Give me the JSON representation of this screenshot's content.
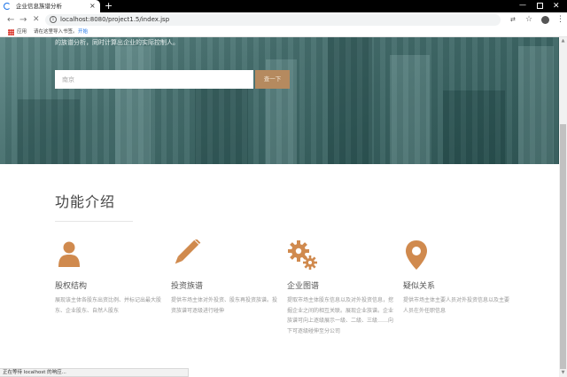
{
  "browser": {
    "tab_title": "企业信息族谱分析",
    "tab_close": "×",
    "new_tab": "+",
    "url": "localhost:8080/project1.5/index.jsp",
    "bookmarks": {
      "apps_label": "应用",
      "import_prompt": "请在这里导入书签。",
      "start_link": "开始"
    },
    "status_text": "正在等待 localhost 的响应..."
  },
  "hero": {
    "description": "的族谱分析，同时计算出企业的实际控制人。",
    "search_placeholder": "南京",
    "search_button": "查一下",
    "accent_color": "#b58a5f"
  },
  "features": {
    "title": "功能介绍",
    "icon_color": "#d08a4e",
    "items": [
      {
        "icon": "person-icon",
        "title": "股权结构",
        "desc": "展现该主体各股东出资比例、并标记出最大股东、企业股东、自然人股东"
      },
      {
        "icon": "pencil-icon",
        "title": "投资族谱",
        "desc": "提供市场主体对外投资、股东再投资族谱。投资族谱可逐级进行碰伸"
      },
      {
        "icon": "gears-icon",
        "title": "企业图谱",
        "desc": "提取市场主体股东信息以及对外投资信息，挖掘企业之间的相互关联。展现企业族谱。企业族谱可向上逐级展示一级、二级、三级……向下可逐级碰伸至分公司"
      },
      {
        "icon": "map-pin-icon",
        "title": "疑似关系",
        "desc": "提供市场主体主要人员对外投资信息以及主要人员在外任职信息"
      }
    ]
  }
}
